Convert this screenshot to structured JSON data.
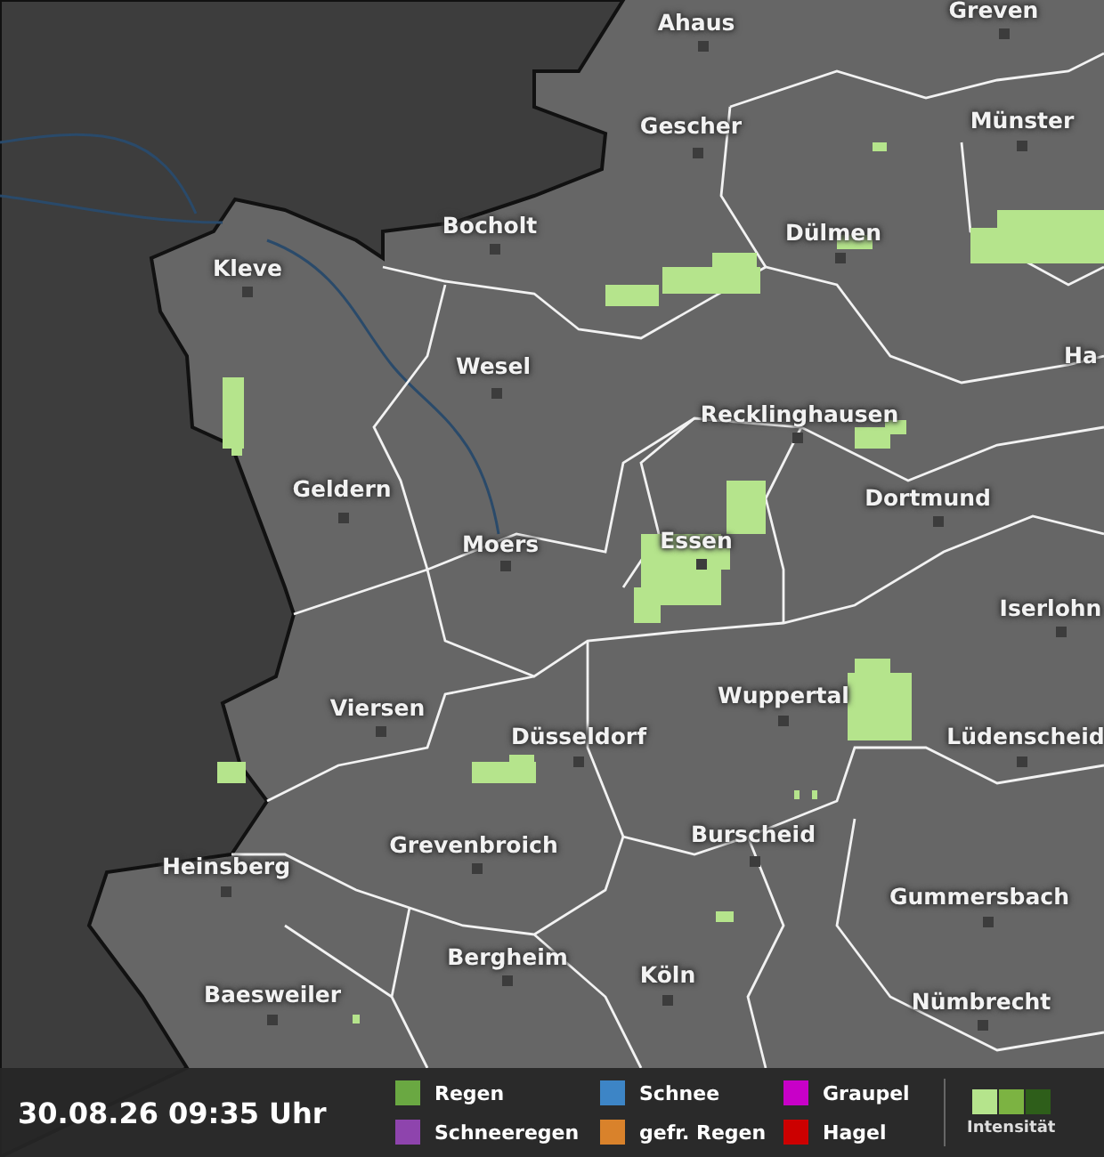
{
  "map": {
    "cities": [
      {
        "name": "Ahaus"
      },
      {
        "name": "Greven"
      },
      {
        "name": "Gescher"
      },
      {
        "name": "Münster"
      },
      {
        "name": "Bocholt"
      },
      {
        "name": "Dülmen"
      },
      {
        "name": "Kleve"
      },
      {
        "name": "Ha"
      },
      {
        "name": "Wesel"
      },
      {
        "name": "Recklinghausen"
      },
      {
        "name": "Geldern"
      },
      {
        "name": "Dortmund"
      },
      {
        "name": "Moers"
      },
      {
        "name": "Essen"
      },
      {
        "name": "Iserlohn"
      },
      {
        "name": "Viersen"
      },
      {
        "name": "Wuppertal"
      },
      {
        "name": "Düsseldorf"
      },
      {
        "name": "Lüdenscheid"
      },
      {
        "name": "Burscheid"
      },
      {
        "name": "Heinsberg"
      },
      {
        "name": "Grevenbroich"
      },
      {
        "name": "Gummersbach"
      },
      {
        "name": "Bergheim"
      },
      {
        "name": "Köln"
      },
      {
        "name": "Nümbrecht"
      },
      {
        "name": "Baesweiler"
      }
    ]
  },
  "legend": {
    "timestamp": "30.08.26 09:35 Uhr",
    "items": [
      {
        "label": "Regen",
        "color": "#6aa842"
      },
      {
        "label": "Schneeregen",
        "color": "#8e44ad"
      },
      {
        "label": "Schnee",
        "color": "#3d85c6"
      },
      {
        "label": "gefr. Regen",
        "color": "#d9822b"
      },
      {
        "label": "Graupel",
        "color": "#c800c8"
      },
      {
        "label": "Hagel",
        "color": "#cc0000"
      }
    ],
    "intensity": {
      "label": "Intensität",
      "levels": [
        {
          "color": "#b5e48c"
        },
        {
          "color": "#7cb342"
        },
        {
          "color": "#2e5e1a"
        }
      ]
    }
  }
}
